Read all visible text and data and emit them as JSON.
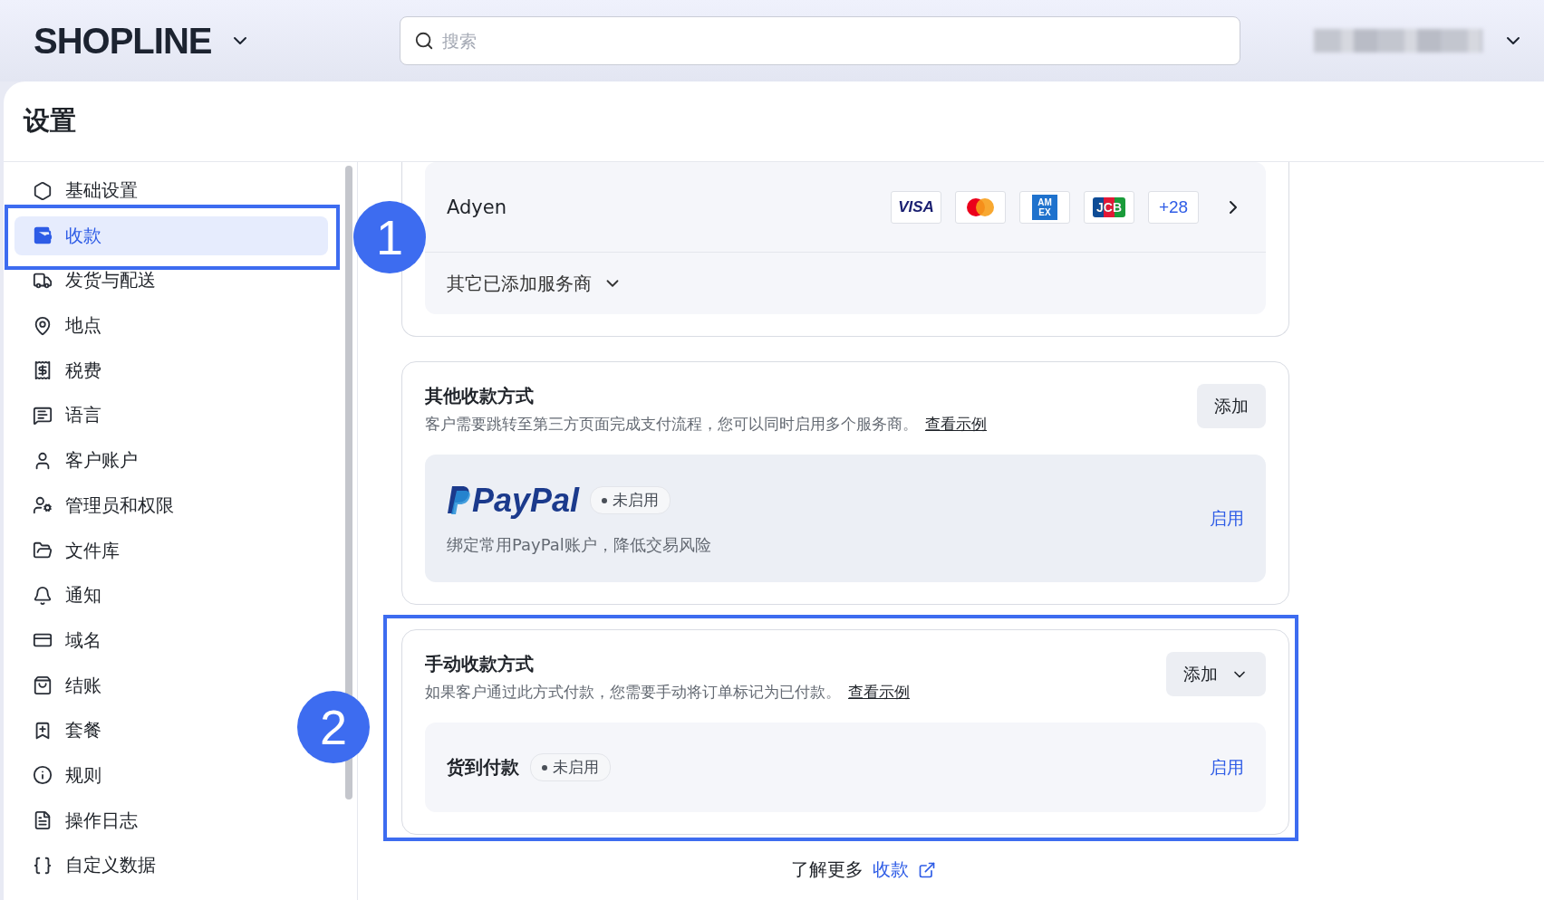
{
  "top_bar": {
    "logo": "SHOPLINE",
    "search": {
      "placeholder": "搜索"
    }
  },
  "page": {
    "title": "设置"
  },
  "sidebar": {
    "items": [
      {
        "label": "基础设置",
        "selected": false
      },
      {
        "label": "收款",
        "selected": true
      },
      {
        "label": "发货与配送",
        "selected": false
      },
      {
        "label": "地点",
        "selected": false
      },
      {
        "label": "税费",
        "selected": false
      },
      {
        "label": "语言",
        "selected": false
      },
      {
        "label": "客户账户",
        "selected": false
      },
      {
        "label": "管理员和权限",
        "selected": false
      },
      {
        "label": "文件库",
        "selected": false
      },
      {
        "label": "通知",
        "selected": false
      },
      {
        "label": "域名",
        "selected": false
      },
      {
        "label": "结账",
        "selected": false
      },
      {
        "label": "套餐",
        "selected": false
      },
      {
        "label": "规则",
        "selected": false
      },
      {
        "label": "操作日志",
        "selected": false
      },
      {
        "label": "自定义数据",
        "selected": false
      }
    ]
  },
  "provider_card": {
    "name": "Adyen",
    "brands": [
      {
        "kind": "visa",
        "label": "VISA"
      },
      {
        "kind": "mastercard"
      },
      {
        "kind": "amex",
        "label": "AM EX"
      },
      {
        "kind": "jcb",
        "label": "JCB"
      },
      {
        "kind": "more",
        "label": "+28"
      }
    ],
    "other_providers": "其它已添加服务商"
  },
  "other_methods": {
    "title": "其他收款方式",
    "description": "客户需要跳转至第三方页面完成支付流程，您可以同时启用多个服务商。",
    "example_link": "查看示例",
    "add_button": "添加",
    "items": [
      {
        "kind": "logo",
        "name": "PayPal",
        "status": "未启用",
        "enabled": false,
        "description": "绑定常用PayPal账户，降低交易风险",
        "action": "启用"
      }
    ]
  },
  "manual_methods": {
    "title": "手动收款方式",
    "description": "如果客户通过此方式付款，您需要手动将订单标记为已付款。",
    "example_link": "查看示例",
    "add_button": "添加",
    "items": [
      {
        "kind": "text",
        "name": "货到付款",
        "status": "未启用",
        "enabled": false,
        "action": "启用"
      }
    ]
  },
  "footer": {
    "text": "了解更多",
    "link": "收款"
  },
  "annotations": [
    {
      "number": "1"
    },
    {
      "number": "2"
    }
  ]
}
